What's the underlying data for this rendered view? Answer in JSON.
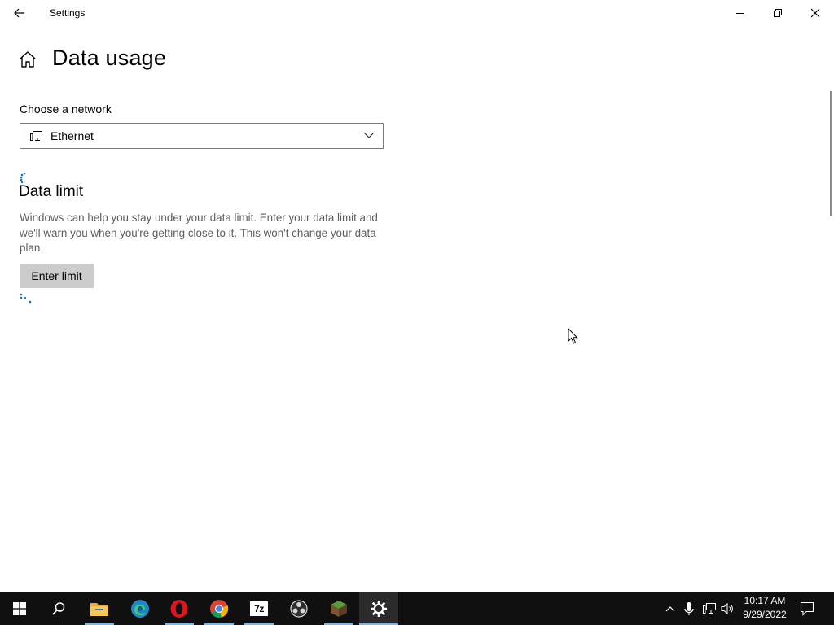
{
  "window": {
    "title": "Settings"
  },
  "header": {
    "title": "Data usage"
  },
  "network": {
    "label": "Choose a network",
    "selected": "Ethernet"
  },
  "data_limit": {
    "title": "Data limit",
    "description": "Windows can help you stay under your data limit. Enter your data limit and we'll warn you when you're getting close to it. This won't change your data plan.",
    "button_label": "Enter limit"
  },
  "taskbar": {
    "apps": [
      "start-icon",
      "search-icon",
      "file-explorer-icon",
      "edge-icon",
      "opera-icon",
      "chrome-icon",
      "7zip-icon",
      "obs-icon",
      "minecraft-icon",
      "settings-icon"
    ],
    "seven_zip_text": "7z",
    "time": "10:17 AM",
    "date": "9/29/2022"
  },
  "colors": {
    "accent": "#0078d7",
    "taskbar": "#101010",
    "button": "#cccccc"
  }
}
